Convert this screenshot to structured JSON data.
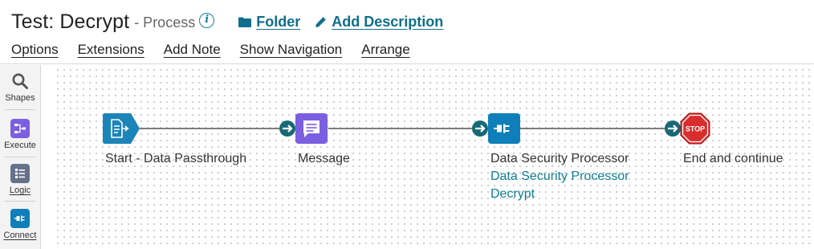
{
  "header": {
    "title": "Test: Decrypt",
    "subtitle": "- Process",
    "folder_label": "Folder",
    "add_description_label": "Add Description"
  },
  "menu": {
    "options": "Options",
    "extensions": "Extensions",
    "add_note": "Add Note",
    "show_navigation": "Show Navigation",
    "arrange": "Arrange"
  },
  "sidebar": {
    "shapes": "Shapes",
    "execute": "Execute",
    "logic": "Logic",
    "connect": "Connect"
  },
  "flow": {
    "start_label": "Start - Data Passthrough",
    "message_label": "Message",
    "processor_label": "Data Security Processor",
    "processor_sub_1": "Data Security Processor",
    "processor_sub_2": "Decrypt",
    "end_label": "End and continue",
    "stop_text": "STOP"
  },
  "colors": {
    "link": "#0f6e8c",
    "start_shape": "#1b84b8",
    "message_shape": "#7b5fe0",
    "connector_shape": "#0e7fb8",
    "connector_arrow": "#176a75",
    "stop": "#d92d2d"
  },
  "icons": {
    "info": "info-icon",
    "folder": "folder-icon",
    "pencil": "pencil-icon",
    "search": "search-icon",
    "execute": "execute-icon",
    "logic": "logic-icon",
    "connect": "connect-icon"
  }
}
